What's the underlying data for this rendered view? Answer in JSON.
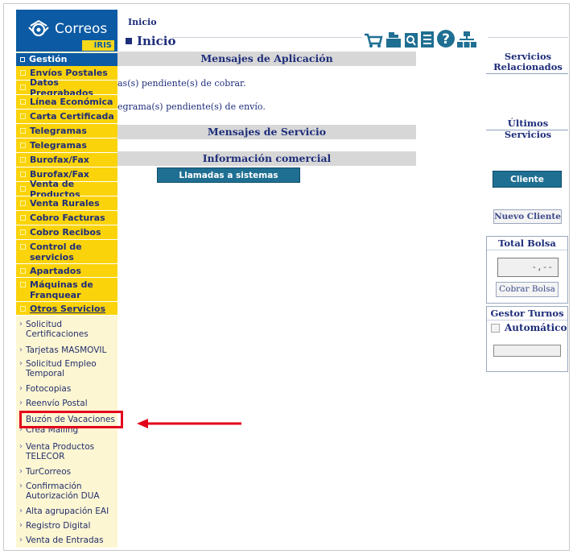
{
  "brand": {
    "name": "Correos",
    "sub": "IRIS"
  },
  "sidebar": {
    "section": "Gestión",
    "items": [
      {
        "label": "Envíos Postales"
      },
      {
        "label": "Datos Pregrabados"
      },
      {
        "label": "Línea Económica"
      },
      {
        "label": "Carta Certificada"
      },
      {
        "label": "Telegramas"
      },
      {
        "label": "Telegramas"
      },
      {
        "label": "Burofax/Fax"
      },
      {
        "label": "Burofax/Fax"
      },
      {
        "label": "Venta de Productos"
      },
      {
        "label": "Venta Rurales"
      },
      {
        "label": "Cobro Facturas"
      },
      {
        "label": "Cobro Recibos"
      },
      {
        "label": "Control de servicios"
      },
      {
        "label": "Apartados"
      },
      {
        "label": "Máquinas de Franquear"
      },
      {
        "label": "Otros Servicios"
      }
    ],
    "subitems": [
      {
        "label": "Solicitud Certificaciones"
      },
      {
        "label": "Tarjetas MASMOVIL"
      },
      {
        "label": "Solicitud Empleo Temporal"
      },
      {
        "label": "Fotocopias"
      },
      {
        "label": "Reenvío Postal"
      },
      {
        "label": "Buzón de Vacaciones"
      },
      {
        "label": "Crea Mailing"
      },
      {
        "label": "Venta Productos TELECOR"
      },
      {
        "label": "TurCorreos"
      },
      {
        "label": "Confirmación Autorización DUA"
      },
      {
        "label": "Alta agrupación EAI"
      },
      {
        "label": "Registro Digital"
      },
      {
        "label": "Venta de Entradas"
      }
    ]
  },
  "header": {
    "breadcrumb": "Inicio",
    "title": "Inicio"
  },
  "main": {
    "app_messages_title": "Mensajes de Aplicación",
    "msg1": "as(s) pendiente(s) de cobrar.",
    "msg2": "egrama(s) pendiente(s) de envío.",
    "service_messages_title": "Mensajes de Servicio",
    "commercial_info_title": "Información comercial",
    "external_button": "Llamadas a sistemas externos"
  },
  "right": {
    "related_title": "Servicios Relacionados",
    "last_services_title": "Últimos Servicios",
    "cliente_tarjeta": "Cliente Tarjeta",
    "nuevo_cliente": "Nuevo Cliente",
    "total_bolsa_title": "Total Bolsa",
    "total_bolsa_value": "-,--",
    "cobrar_bolsa": "Cobrar Bolsa",
    "gestor_turnos_title": "Gestor Turnos",
    "automatico": "Automático"
  },
  "colors": {
    "brand_blue": "#0b5aa3",
    "menu_yellow": "#fbd30a",
    "highlight_red": "#e3001b",
    "button_teal": "#1f6f92"
  }
}
